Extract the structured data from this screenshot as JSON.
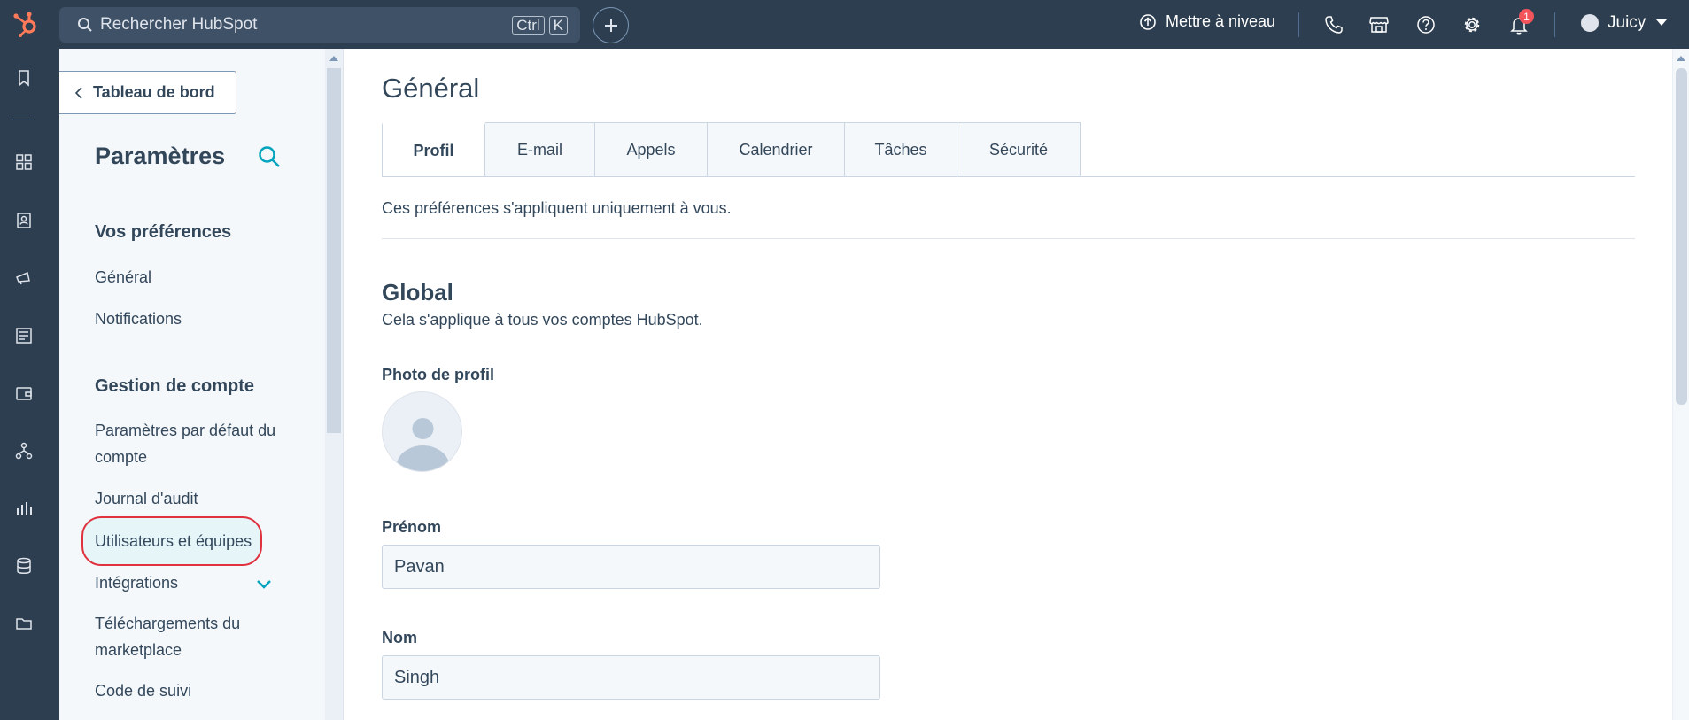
{
  "colors": {
    "topbar": "#2d3e50",
    "accent_orange": "#ff7a59",
    "accent_teal": "#00a4bd",
    "text": "#33475b",
    "highlight_ring": "#e0313e"
  },
  "topbar": {
    "search_placeholder": "Rechercher HubSpot",
    "shortcut_ctrl": "Ctrl",
    "shortcut_key": "K",
    "upgrade_label": "Mettre à niveau",
    "notification_count": "1",
    "user_name": "Juicy"
  },
  "sidebar": {
    "back_label": "Tableau de bord",
    "title": "Paramètres",
    "sections": [
      {
        "heading": "Vos préférences",
        "items": [
          "Général",
          "Notifications"
        ]
      },
      {
        "heading": "Gestion de compte",
        "items": [
          "Paramètres par défaut du compte",
          "Journal d'audit",
          "Utilisateurs et équipes",
          "Intégrations",
          "Téléchargements du marketplace",
          "Code de suivi"
        ]
      }
    ]
  },
  "main": {
    "title": "Général",
    "tabs": [
      "Profil",
      "E-mail",
      "Appels",
      "Calendrier",
      "Tâches",
      "Sécurité"
    ],
    "active_tab": "Profil",
    "note": "Ces préférences s'appliquent uniquement à vous.",
    "section_title": "Global",
    "section_desc": "Cela s'applique à tous vos comptes HubSpot.",
    "photo_label": "Photo de profil",
    "first_name_label": "Prénom",
    "first_name_value": "Pavan",
    "last_name_label": "Nom",
    "last_name_value": "Singh"
  },
  "icons": {
    "logo": "hubspot-sprocket-icon",
    "search": "search-icon",
    "add": "plus-icon",
    "upgrade": "upgrade-arrow-icon",
    "phone": "phone-icon",
    "marketplace": "marketplace-icon",
    "help": "help-icon",
    "settings": "gear-icon",
    "notifications": "bell-icon"
  }
}
